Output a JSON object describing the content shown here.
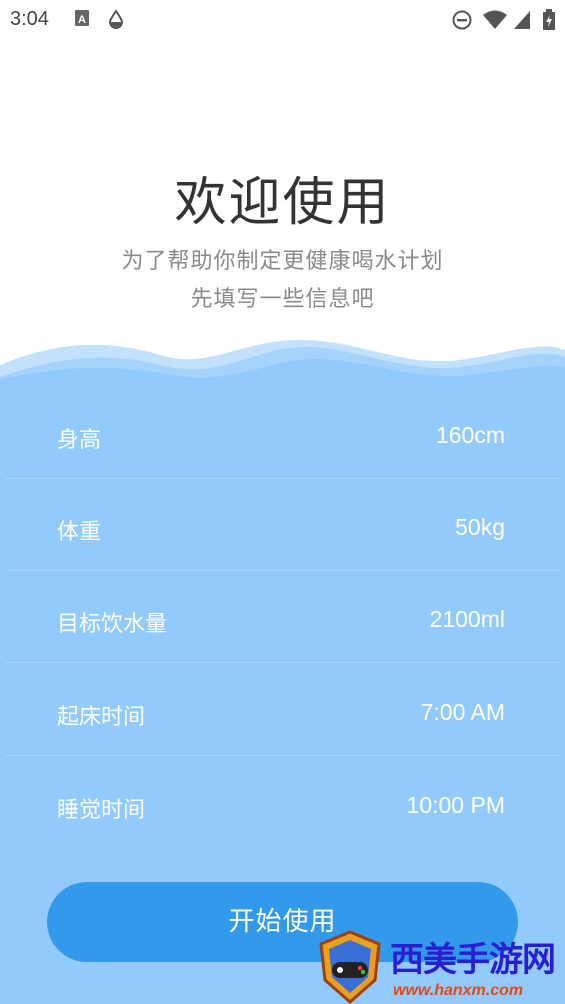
{
  "status_bar": {
    "time": "3:04"
  },
  "welcome": {
    "title": "欢迎使用",
    "subtitle_line1": "为了帮助你制定更健康喝水计划",
    "subtitle_line2": "先填写一些信息吧"
  },
  "settings": [
    {
      "label": "身高",
      "value": "160cm"
    },
    {
      "label": "体重",
      "value": "50kg"
    },
    {
      "label": "目标饮水量",
      "value": "2100ml"
    },
    {
      "label": "起床时间",
      "value": "7:00 AM"
    },
    {
      "label": "睡觉时间",
      "value": "10:00 PM"
    }
  ],
  "start_button": {
    "label": "开始使用"
  },
  "watermark": {
    "name": "西美手游网",
    "url": "www.hanxm.com"
  },
  "colors": {
    "accent": "#3399ea",
    "panel": "#92cbfb",
    "wave": "#b9dcfb"
  }
}
